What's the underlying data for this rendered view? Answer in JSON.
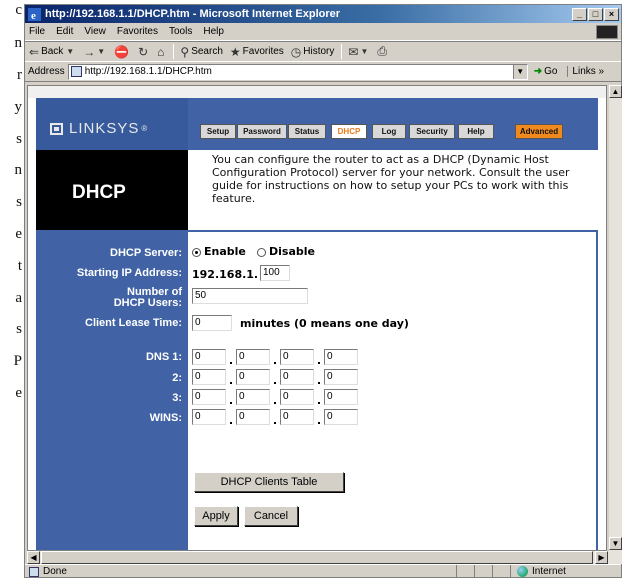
{
  "book_text": [
    "c",
    "n",
    "r",
    "y",
    "s",
    "n",
    "s",
    "e",
    "t",
    "a",
    "s",
    "P",
    "e"
  ],
  "browser": {
    "title": "http://192.168.1.1/DHCP.htm - Microsoft Internet Explorer",
    "window_buttons": [
      "_",
      "□",
      "×"
    ],
    "menu": [
      "File",
      "Edit",
      "View",
      "Favorites",
      "Tools",
      "Help"
    ],
    "toolbar": {
      "back": "Back",
      "search": "Search",
      "favorites": "Favorites",
      "history": "History"
    },
    "address_label": "Address",
    "address_value": "http://192.168.1.1/DHCP.htm",
    "go_label": "Go",
    "links_label": "Links »",
    "status_text": "Done",
    "zone_text": "Internet"
  },
  "linksys": {
    "logo": "LINKSYS",
    "registered": "®",
    "tabs": [
      {
        "label": "Setup"
      },
      {
        "label": "Password"
      },
      {
        "label": "Status"
      },
      {
        "label": "DHCP"
      },
      {
        "label": "Log"
      },
      {
        "label": "Security"
      },
      {
        "label": "Help"
      }
    ],
    "advanced_tab": "Advanced",
    "page_title": "DHCP",
    "description": "You can configure the router to act as a DHCP (Dynamic Host Configuration Protocol) server for your network. Consult the user guide for instructions on how to setup your PCs to work with this feature.",
    "form": {
      "dhcp_server_label": "DHCP Server:",
      "enable_label": "Enable",
      "disable_label": "Disable",
      "starting_ip_label": "Starting IP Address:",
      "ip_prefix": "192.168.1.",
      "ip_last": "100",
      "num_users_label_1": "Number of",
      "num_users_label_2": "DHCP Users:",
      "num_users": "50",
      "lease_label": "Client Lease Time:",
      "lease_value": "0",
      "lease_suffix": "minutes (0 means one day)",
      "dns1_label": "DNS 1:",
      "dns2_label": "2:",
      "dns3_label": "3:",
      "wins_label": "WINS:",
      "dns1": [
        "0",
        "0",
        "0",
        "0"
      ],
      "dns2": [
        "0",
        "0",
        "0",
        "0"
      ],
      "dns3": [
        "0",
        "0",
        "0",
        "0"
      ],
      "wins": [
        "0",
        "0",
        "0",
        "0"
      ],
      "clients_table_button": "DHCP Clients Table",
      "apply_button": "Apply",
      "cancel_button": "Cancel"
    }
  },
  "colors": {
    "linksys_blue": "#4163a5",
    "active_tab_text": "#e87b1e",
    "advanced_tab": "#f08a1e"
  }
}
